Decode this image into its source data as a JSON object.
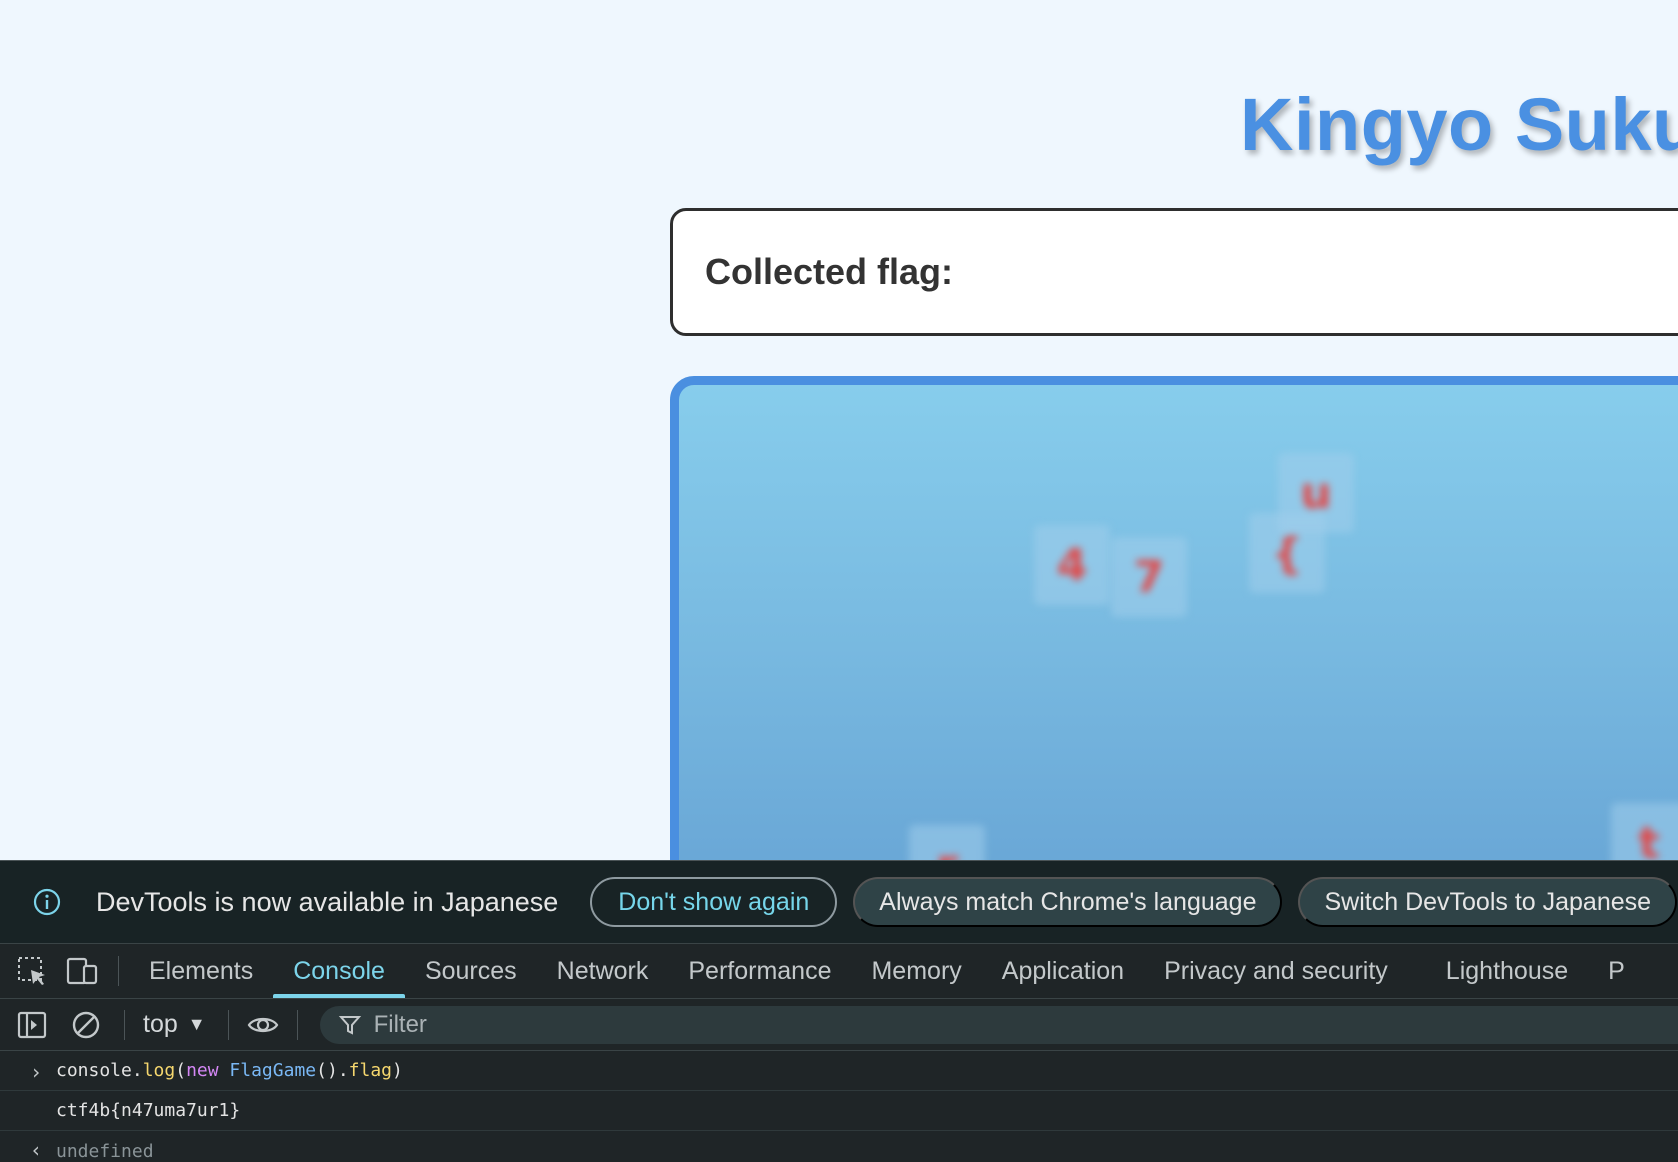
{
  "page": {
    "title": "Kingyo Suku",
    "flag_label": "Collected flag:",
    "flag_value": ""
  },
  "tank": {
    "fish": [
      {
        "char": "4"
      },
      {
        "char": "7"
      },
      {
        "char": "{"
      },
      {
        "char": "u"
      },
      {
        "char": "r"
      },
      {
        "char": "t"
      }
    ]
  },
  "devtools": {
    "notice": {
      "text": "DevTools is now available in Japanese",
      "buttons": [
        "Don't show again",
        "Always match Chrome's language",
        "Switch DevTools to Japanese"
      ]
    },
    "tabs": [
      "Elements",
      "Console",
      "Sources",
      "Network",
      "Performance",
      "Memory",
      "Application",
      "Privacy and security",
      "Lighthouse",
      "P"
    ],
    "active_tab": "Console",
    "toolbar": {
      "context": "top",
      "filter_placeholder": "Filter"
    },
    "console": {
      "input": {
        "obj": "console",
        "dot1": ".",
        "method": "log",
        "paren_open": "(",
        "kw": "new",
        "space": " ",
        "cls": "FlagGame",
        "call": "()",
        "dot2": ".",
        "prop": "flag",
        "paren_close": ")"
      },
      "output": "ctf4b{n47uma7ur1}",
      "result": "undefined"
    },
    "colors": {
      "accent": "#7cd4ea",
      "panel_bg": "#1f2527"
    },
    "icons": {
      "info": "info-icon",
      "inspect": "inspect-element-icon",
      "device": "device-toolbar-icon",
      "sidebar": "sidebar-toggle-icon",
      "clear": "clear-console-icon",
      "eye": "eye-icon",
      "filter": "filter-icon"
    }
  }
}
